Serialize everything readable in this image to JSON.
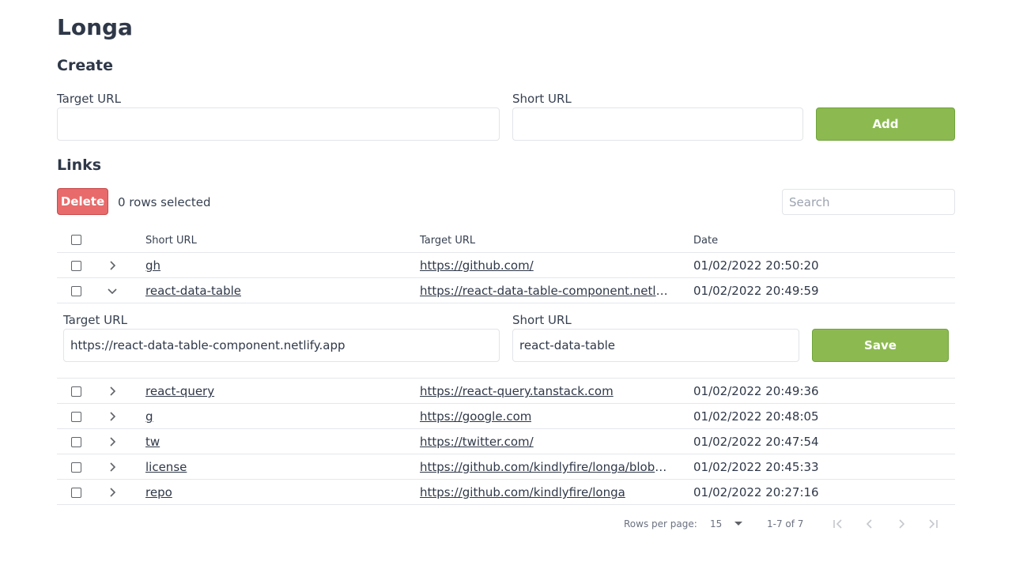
{
  "app": {
    "title": "Longa"
  },
  "create": {
    "heading": "Create",
    "target_label": "Target URL",
    "target_value": "",
    "short_label": "Short URL",
    "short_value": "",
    "add_label": "Add"
  },
  "links": {
    "heading": "Links",
    "delete_label": "Delete",
    "selected_text": "0 rows selected",
    "search_placeholder": "Search"
  },
  "table": {
    "columns": [
      "Short URL",
      "Target URL",
      "Date"
    ],
    "rows": [
      {
        "short": "gh",
        "target": "https://github.com/",
        "date": "01/02/2022 20:50:20",
        "expanded": false
      },
      {
        "short": "react-data-table",
        "target": "https://react-data-table-component.netlify...",
        "date": "01/02/2022 20:49:59",
        "expanded": true
      },
      {
        "short": "react-query",
        "target": "https://react-query.tanstack.com",
        "date": "01/02/2022 20:49:36",
        "expanded": false
      },
      {
        "short": "g",
        "target": "https://google.com",
        "date": "01/02/2022 20:48:05",
        "expanded": false
      },
      {
        "short": "tw",
        "target": "https://twitter.com/",
        "date": "01/02/2022 20:47:54",
        "expanded": false
      },
      {
        "short": "license",
        "target": "https://github.com/kindlyfire/longa/blob/...",
        "date": "01/02/2022 20:45:33",
        "expanded": false
      },
      {
        "short": "repo",
        "target": "https://github.com/kindlyfire/longa",
        "date": "01/02/2022 20:27:16",
        "expanded": false
      }
    ]
  },
  "edit": {
    "target_label": "Target URL",
    "target_value": "https://react-data-table-component.netlify.app",
    "short_label": "Short URL",
    "short_value": "react-data-table",
    "save_label": "Save"
  },
  "pagination": {
    "rows_per_page_label": "Rows per page:",
    "rows_per_page_value": "15",
    "range": "1-7 of 7"
  },
  "colors": {
    "accent_green": "#8cba51",
    "danger_red": "#e86a6a",
    "heading": "#2f3848"
  },
  "icons": [
    "chevron-right-icon",
    "chevron-down-icon",
    "dropdown-caret-icon",
    "first-page-icon",
    "prev-page-icon",
    "next-page-icon",
    "last-page-icon"
  ]
}
